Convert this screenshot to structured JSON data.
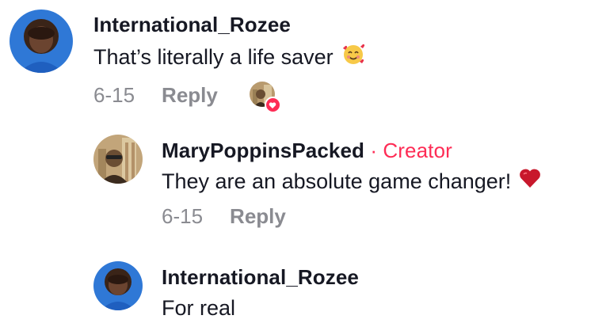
{
  "comments": [
    {
      "username": "International_Rozee",
      "text": "That’s literally a life saver",
      "emoji": "smiling-face-with-hearts",
      "date": "6-15",
      "reply_label": "Reply",
      "liked_by_creator": true
    },
    {
      "username": "MaryPoppinsPacked",
      "creator_label": "· Creator",
      "text": "They are an absolute game changer!",
      "emoji": "red-heart",
      "date": "6-15",
      "reply_label": "Reply"
    },
    {
      "username": "International_Rozee",
      "text": "For real"
    }
  ],
  "colors": {
    "creator": "#fe2c55",
    "meta": "#8a8b91",
    "text": "#161823"
  }
}
